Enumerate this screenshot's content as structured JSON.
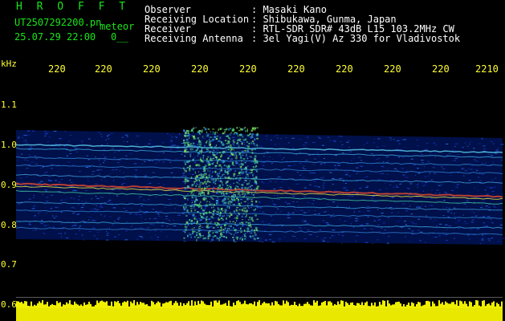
{
  "header": {
    "brand": "H R O F F T",
    "filename": "UT2507292200.pn",
    "meteor_label": "meteor",
    "datetime": "25.07.29 22:00",
    "counter": "0__",
    "info": [
      {
        "label": "Observer",
        "value": ": Masaki Kano"
      },
      {
        "label": "Receiving Location",
        "value": ": Shibukawa, Gunma, Japan"
      },
      {
        "label": "Receiver",
        "value": ": RTL-SDR SDR# 43dB L15 103.2MHz CW"
      },
      {
        "label": "Receiving Antenna",
        "value": ": 3el Yagi(V) Az 330 for Vladivostok"
      }
    ]
  },
  "x_axis": {
    "ticks": [
      "220",
      "220",
      "220",
      "220",
      "220",
      "220",
      "220",
      "220",
      "220",
      "2210"
    ]
  },
  "y_axis": {
    "unit": "kHz",
    "ticks": [
      "1.1",
      "1.0",
      "0.9",
      "0.8",
      "0.7",
      "0.6"
    ]
  },
  "colors": {
    "header_text": "#19e619",
    "info_text": "#ffffff",
    "tick_text": "#ffff33",
    "background": "#000000",
    "plot_bg": "#000033"
  }
}
